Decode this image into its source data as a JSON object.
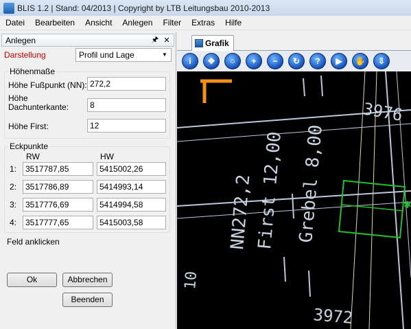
{
  "window": {
    "title": "BLIS 1.2 | Stand: 04/2013 | Copyright by LTB Leitungsbau 2010-2013"
  },
  "menu": [
    "Datei",
    "Bearbeiten",
    "Ansicht",
    "Anlegen",
    "Filter",
    "Extras",
    "Hilfe"
  ],
  "panel": {
    "title": "Anlegen",
    "darstellung_label": "Darstellung",
    "darstellung_value": "Profil und Lage",
    "hoehen": {
      "legend": "Höhenmaße",
      "fusspunkt_label": "Höhe Fußpunkt (NN):",
      "fusspunkt_value": "272,2",
      "dachunterkante_label_1": "Höhe",
      "dachunterkante_label_2": "Dachunterkante:",
      "dachunterkante_value": "8",
      "first_label": "Höhe First:",
      "first_value": "12"
    },
    "eckpunkte": {
      "legend": "Eckpunkte",
      "col_rw": "RW",
      "col_hw": "HW",
      "rows": [
        {
          "num": "1:",
          "rw": "3517787,85",
          "hw": "5415002,26"
        },
        {
          "num": "2:",
          "rw": "3517786,89",
          "hw": "5414993,14"
        },
        {
          "num": "3:",
          "rw": "3517776,69",
          "hw": "5414994,58"
        },
        {
          "num": "4:",
          "rw": "3517777,65",
          "hw": "5415003,58"
        }
      ]
    },
    "hint": "Feld anklicken",
    "buttons": {
      "ok": "Ok",
      "abbrechen": "Abbrechen",
      "beenden": "Beenden"
    }
  },
  "grafik": {
    "tab_label": "Grafik",
    "tools": [
      "info-icon",
      "pan-icon",
      "zoom-icon",
      "zoom-in-icon",
      "zoom-out-icon",
      "refresh-icon",
      "help-icon",
      "forward-icon",
      "hand-icon",
      "export-icon"
    ],
    "map_text": {
      "nn": "NN272,2",
      "first": "First 12,00",
      "giebel": "Grebel 8,00",
      "num_a": "3976",
      "num_b": "3972",
      "num_c": "10"
    }
  },
  "colors": {
    "accent": "#1852b9",
    "darstellung_label": "#c00000",
    "map_bg": "#000000",
    "building_outline": "#22c22a",
    "orange_mark": "#f39019"
  }
}
